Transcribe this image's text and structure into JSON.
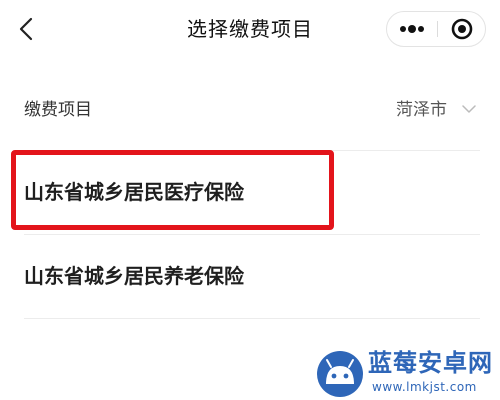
{
  "header": {
    "title": "选择缴费项目",
    "back_icon": "chevron-left-icon",
    "more_icon": "more-dots-icon",
    "close_icon": "target-circle-icon"
  },
  "section": {
    "label": "缴费项目",
    "city_selector": {
      "value": "菏泽市",
      "icon": "chevron-down-icon"
    }
  },
  "items": [
    {
      "label": "山东省城乡居民医疗保险",
      "highlighted": true
    },
    {
      "label": "山东省城乡居民养老保险",
      "highlighted": false
    }
  ],
  "annotation": {
    "highlight_color": "#e3141b"
  },
  "watermark": {
    "title": "蓝莓安卓网",
    "url": "www.lmkjst.com",
    "color": "#2e66b8"
  }
}
